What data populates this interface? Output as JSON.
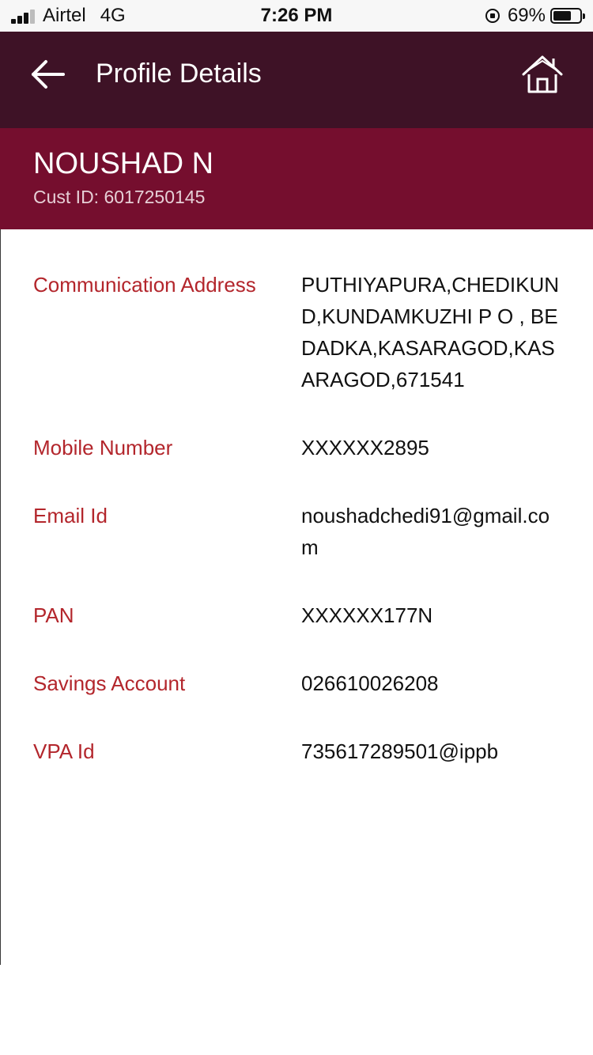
{
  "status_bar": {
    "carrier": "Airtel",
    "network": "4G",
    "time": "7:26 PM",
    "battery_percent": "69%",
    "battery_level": 0.69,
    "signal_bars_active": 3,
    "signal_bars_total": 4
  },
  "app_bar": {
    "title": "Profile Details",
    "back_icon": "arrow-left-icon",
    "home_icon": "home-icon"
  },
  "customer": {
    "name": "NOUSHAD N",
    "cust_id": "Cust ID: 6017250145"
  },
  "details": [
    {
      "label": "Communication Address",
      "value": "PUTHIYAPURA,CHEDIKUND,KUNDAMKUZHI P O , BEDADKA,KASARAGOD,KASARAGOD,671541"
    },
    {
      "label": "Mobile Number",
      "value": "XXXXXX2895"
    },
    {
      "label": "Email Id",
      "value": "noushadchedi91@gmail.com"
    },
    {
      "label": "PAN",
      "value": "XXXXXX177N"
    },
    {
      "label": "Savings Account",
      "value": "026610026208"
    },
    {
      "label": "VPA Id",
      "value": "735617289501@ippb"
    }
  ],
  "colors": {
    "app_bar": "#3e1226",
    "customer_header": "#750e2e",
    "label_red": "#b3262c",
    "value_text": "#111111"
  }
}
